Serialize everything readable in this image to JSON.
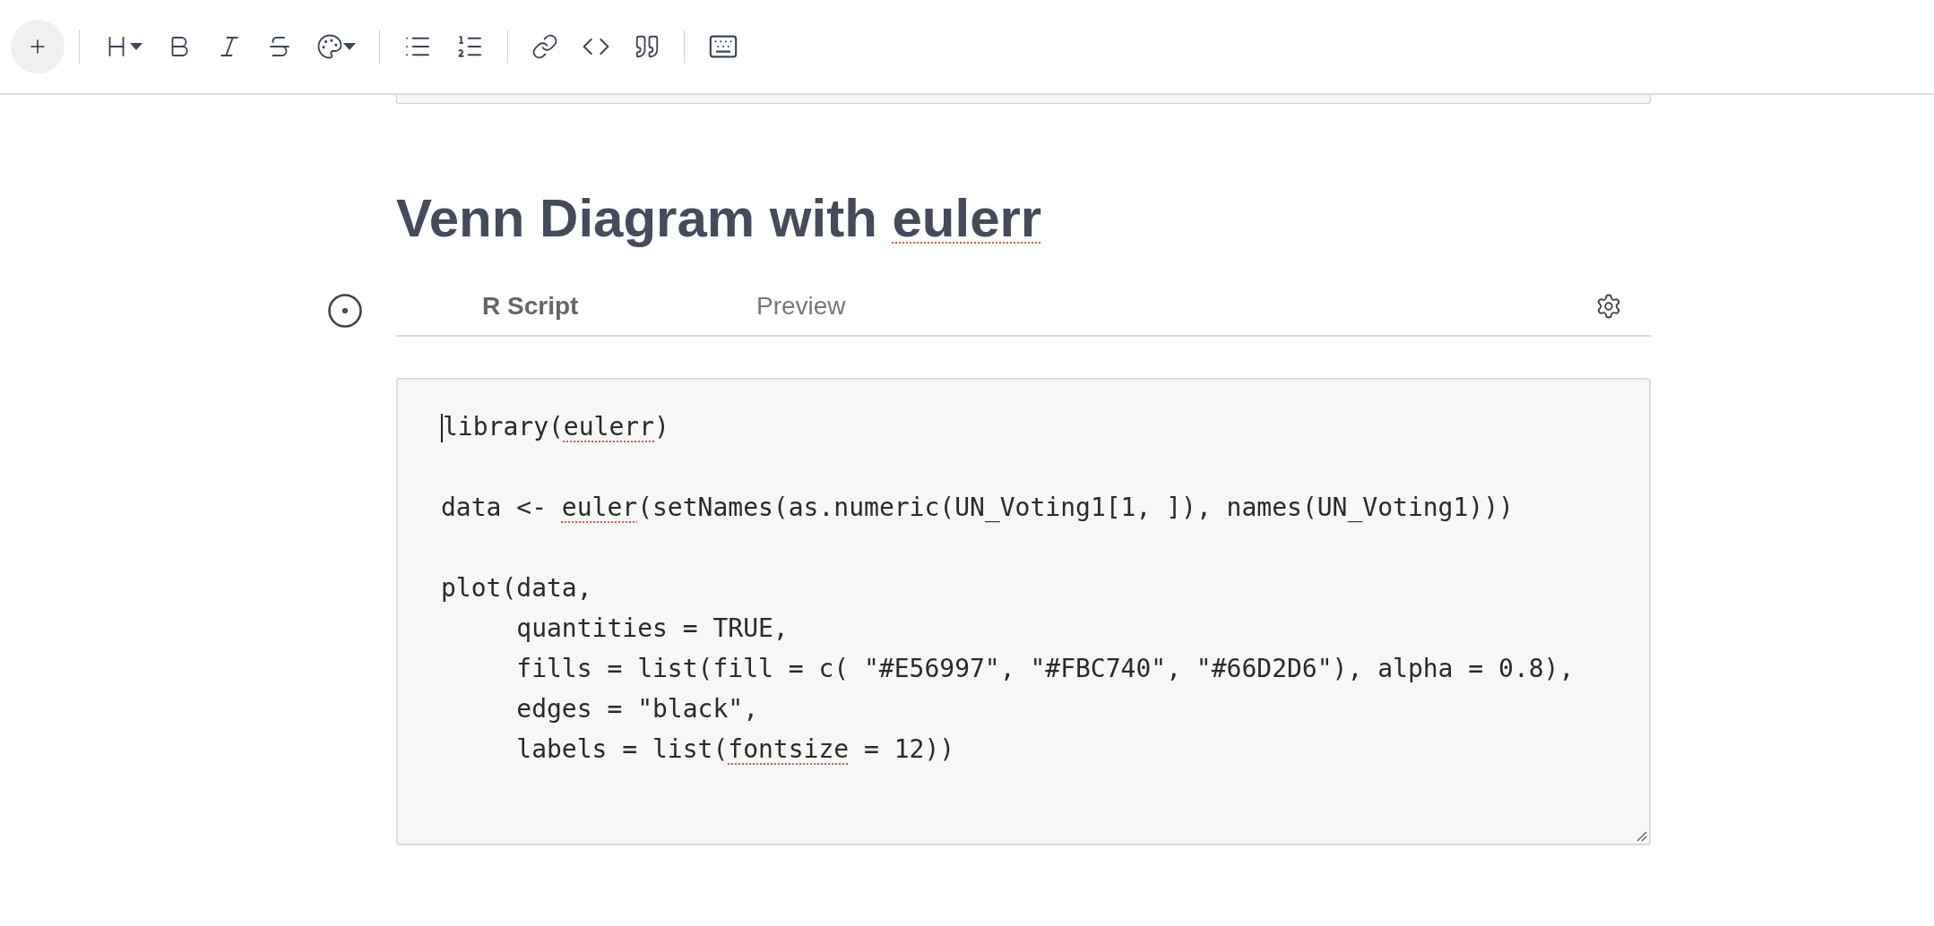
{
  "heading": {
    "segments": [
      {
        "text": "Venn Diagram with ",
        "misspelled": false
      },
      {
        "text": "eulerr",
        "misspelled": true
      }
    ]
  },
  "tabs": [
    {
      "label": "R Script",
      "selected": true
    },
    {
      "label": "Preview",
      "selected": false
    }
  ],
  "code": {
    "lines": [
      {
        "kind": "code",
        "caret": true,
        "segments": [
          {
            "text": "library(",
            "misspelled": false
          },
          {
            "text": "eulerr",
            "misspelled": true
          },
          {
            "text": ")",
            "misspelled": false
          }
        ]
      },
      {
        "kind": "blank"
      },
      {
        "kind": "code",
        "caret": false,
        "segments": [
          {
            "text": "data <- ",
            "misspelled": false
          },
          {
            "text": "euler",
            "misspelled": true
          },
          {
            "text": "(setNames(as.numeric(UN_Voting1[1, ]), names(UN_Voting1)))",
            "misspelled": false
          }
        ]
      },
      {
        "kind": "blank"
      },
      {
        "kind": "code",
        "caret": false,
        "segments": [
          {
            "text": "plot(data,",
            "misspelled": false
          }
        ]
      },
      {
        "kind": "code",
        "caret": false,
        "segments": [
          {
            "text": "     quantities = TRUE,",
            "misspelled": false
          }
        ]
      },
      {
        "kind": "code",
        "caret": false,
        "segments": [
          {
            "text": "     fills = list(fill = c( \"#E56997\", \"#FBC740\", \"#66D2D6\"), alpha = 0.8),",
            "misspelled": false
          }
        ]
      },
      {
        "kind": "code",
        "caret": false,
        "segments": [
          {
            "text": "     edges = \"black\",",
            "misspelled": false
          }
        ]
      },
      {
        "kind": "code",
        "caret": false,
        "segments": [
          {
            "text": "     labels = list(",
            "misspelled": false
          },
          {
            "text": "fontsize",
            "misspelled": true
          },
          {
            "text": " = 12))",
            "misspelled": false
          }
        ]
      }
    ]
  }
}
